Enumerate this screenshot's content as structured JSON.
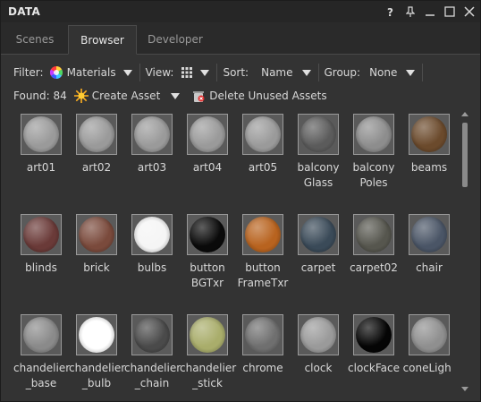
{
  "window": {
    "title": "DATA"
  },
  "titlebar_buttons": [
    "help-icon",
    "pin-icon",
    "minimize-icon",
    "maximize-icon",
    "close-icon"
  ],
  "tabs": [
    {
      "label": "Scenes",
      "active": false
    },
    {
      "label": "Browser",
      "active": true
    },
    {
      "label": "Developer",
      "active": false
    }
  ],
  "toolbar": {
    "filter_label": "Filter:",
    "filter_value": "Materials",
    "view_label": "View:",
    "view_icon": "grid-view-icon",
    "sort_label": "Sort:",
    "sort_value": "Name",
    "group_label": "Group:",
    "group_value": "None",
    "found_text": "Found: 84",
    "create_asset_label": "Create Asset",
    "delete_unused_label": "Delete Unused Assets"
  },
  "assets": [
    {
      "name": "art01",
      "color": "#9a9a9a"
    },
    {
      "name": "art02",
      "color": "#9a9a9a"
    },
    {
      "name": "art03",
      "color": "#9a9a9a"
    },
    {
      "name": "art04",
      "color": "#9a9a9a"
    },
    {
      "name": "art05",
      "color": "#9a9a9a"
    },
    {
      "name": "balcony\nGlass",
      "color": "#5b5b5b"
    },
    {
      "name": "balcony\nPoles",
      "color": "#8d8d8d"
    },
    {
      "name": "beams",
      "color": "#6b4a2c"
    },
    {
      "name": "blinds",
      "color": "#6a3a38"
    },
    {
      "name": "brick",
      "color": "#7a4a3c"
    },
    {
      "name": "bulbs",
      "color": "#f5f5f5"
    },
    {
      "name": "button\nBGTxr",
      "color": "#0a0a0a"
    },
    {
      "name": "button\nFrameTxr",
      "color": "#b8631f"
    },
    {
      "name": "carpet",
      "color": "#3a4a58"
    },
    {
      "name": "carpet02",
      "color": "#56564e"
    },
    {
      "name": "chair",
      "color": "#4a5566"
    },
    {
      "name": "chandelier\n_base",
      "color": "#8a8a8a"
    },
    {
      "name": "chandelier\n_bulb",
      "color": "#ffffff"
    },
    {
      "name": "chandelier\n_chain",
      "color": "#4a4a4a"
    },
    {
      "name": "chandelier\n_stick",
      "color": "#a9ad6b"
    },
    {
      "name": "chrome",
      "color": "#6f6f6f"
    },
    {
      "name": "clock",
      "color": "#9a9a9a"
    },
    {
      "name": "clockFace",
      "color": "#050505"
    },
    {
      "name": "coneLight",
      "color": "#8f8f8f"
    }
  ]
}
